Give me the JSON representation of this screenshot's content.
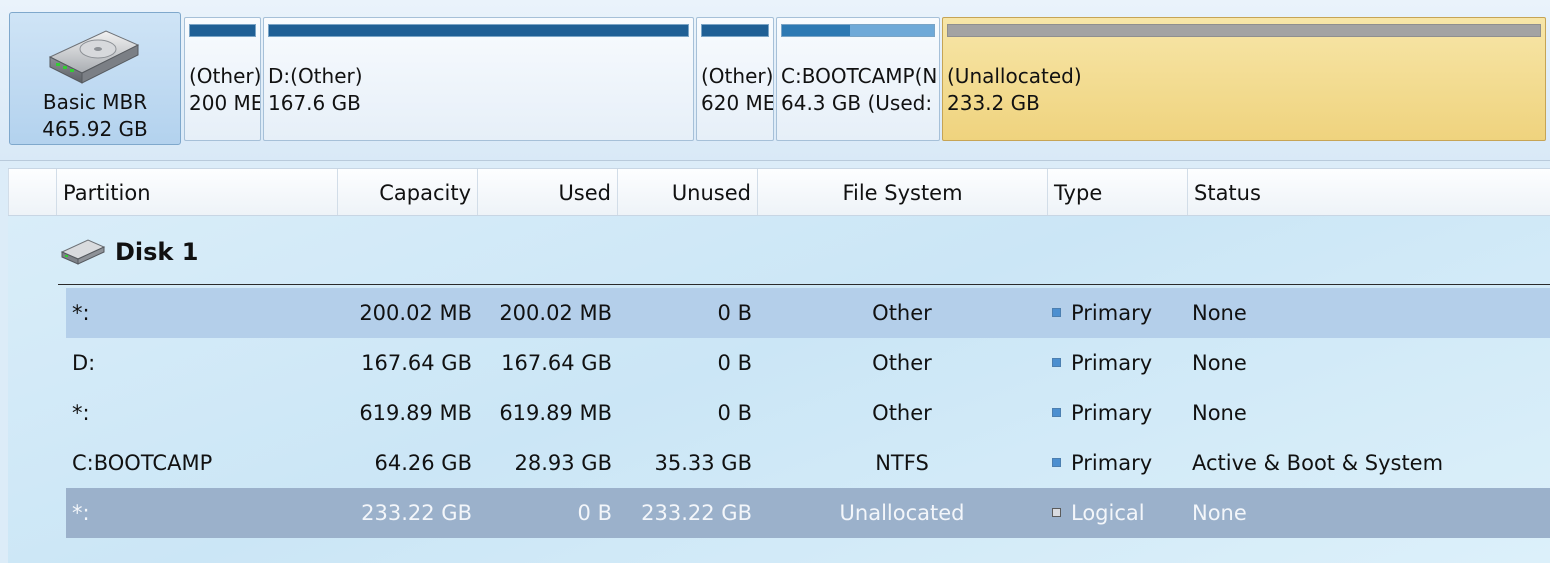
{
  "disk_map": {
    "disk": {
      "type": "Basic MBR",
      "size": "465.92 GB",
      "icon": "hard-disk-icon"
    },
    "partitions": [
      {
        "name": "(Other)",
        "size": "200 ME",
        "used_fraction": 1.0,
        "kind": "primary"
      },
      {
        "name": "D:(Other)",
        "size": "167.6 GB",
        "used_fraction": 1.0,
        "kind": "primary"
      },
      {
        "name": "(Other)",
        "size": "620 ME",
        "used_fraction": 1.0,
        "kind": "primary"
      },
      {
        "name": "C:BOOTCAMP(N",
        "size": "64.3 GB (Used:",
        "used_fraction": 0.45,
        "kind": "primary"
      },
      {
        "name": "(Unallocated)",
        "size": "233.2 GB",
        "used_fraction": 0.0,
        "kind": "unallocated"
      }
    ]
  },
  "table": {
    "headers": {
      "partition": "Partition",
      "capacity": "Capacity",
      "used": "Used",
      "unused": "Unused",
      "filesystem": "File System",
      "type": "Type",
      "status": "Status"
    },
    "group": {
      "label": "Disk 1",
      "icon": "hard-disk-icon"
    },
    "rows": [
      {
        "partition": "*:",
        "capacity": "200.02 MB",
        "used": "200.02 MB",
        "unused": "0 B",
        "filesystem": "Other",
        "type": "Primary",
        "status": "None",
        "highlight": "selected-light"
      },
      {
        "partition": "D:",
        "capacity": "167.64 GB",
        "used": "167.64 GB",
        "unused": "0 B",
        "filesystem": "Other",
        "type": "Primary",
        "status": "None",
        "highlight": "none"
      },
      {
        "partition": "*:",
        "capacity": "619.89 MB",
        "used": "619.89 MB",
        "unused": "0 B",
        "filesystem": "Other",
        "type": "Primary",
        "status": "None",
        "highlight": "none"
      },
      {
        "partition": "C:BOOTCAMP",
        "capacity": "64.26 GB",
        "used": "28.93 GB",
        "unused": "35.33 GB",
        "filesystem": "NTFS",
        "type": "Primary",
        "status": "Active & Boot & System",
        "highlight": "none"
      },
      {
        "partition": "*:",
        "capacity": "233.22 GB",
        "used": "0 B",
        "unused": "233.22 GB",
        "filesystem": "Unallocated",
        "type": "Logical",
        "status": "None",
        "highlight": "selected-dark"
      }
    ]
  },
  "colors": {
    "selected_light": "#b4cfea",
    "selected_dark": "#9bb1cb",
    "unallocated_block": "#f2d98c",
    "usage_bar": "#2d79b3"
  }
}
